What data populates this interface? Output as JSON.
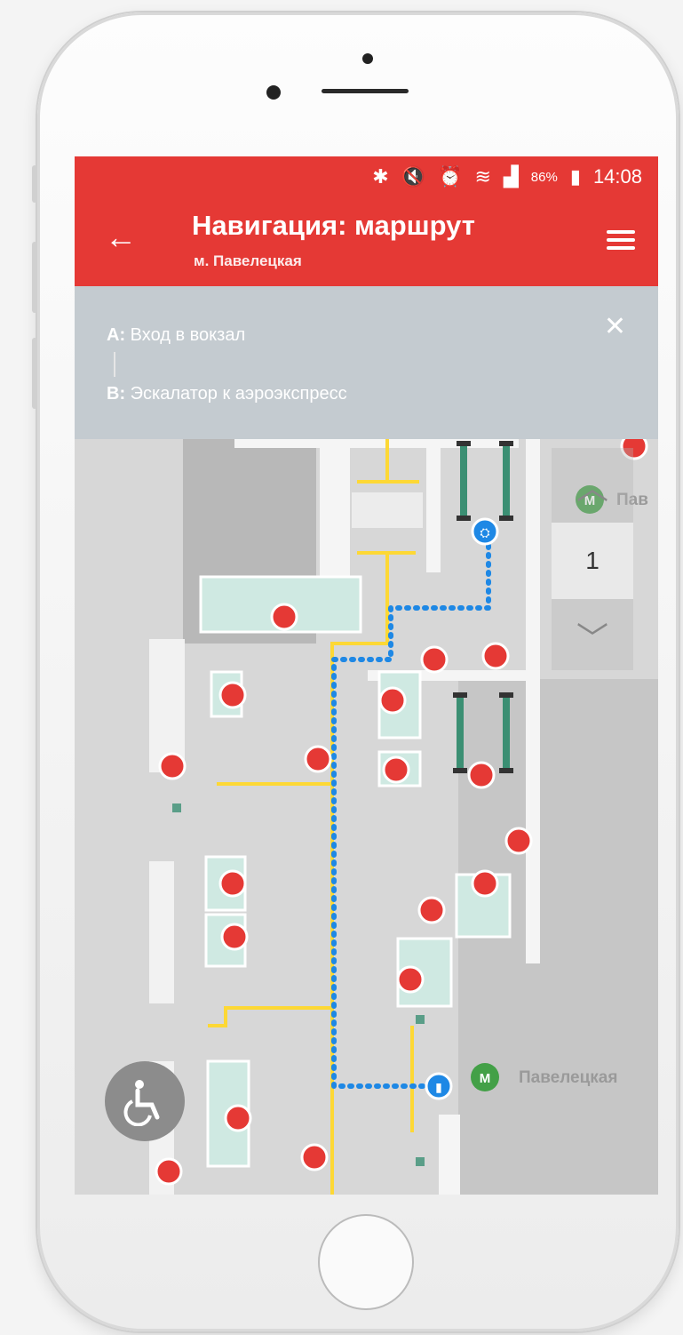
{
  "status": {
    "icons": [
      "bluetooth-icon",
      "mute-icon",
      "alarm-icon",
      "wifi-icon",
      "signal-icon"
    ],
    "battery": "86%",
    "time": "14:08"
  },
  "header": {
    "title": "Навигация: маршрут",
    "subtitle": "м. Павелецкая"
  },
  "route": {
    "a_prefix": "A:",
    "a_text": "Вход в вокзал",
    "b_prefix": "B:",
    "b_text": "Эскалатор к аэроэкспресс"
  },
  "floor": {
    "current": "1"
  },
  "map": {
    "metro_label_1": "Пав",
    "metro_label_2": "Павелецкая"
  },
  "colors": {
    "accent": "#e53935",
    "route": "#1e88e5",
    "path": "#fdd835",
    "metro": "#43a047"
  }
}
